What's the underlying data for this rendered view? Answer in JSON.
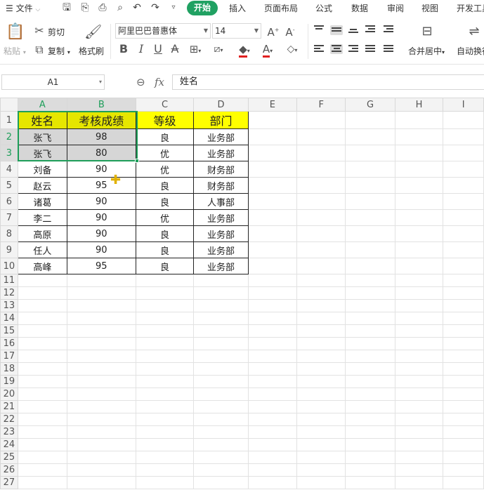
{
  "menu": {
    "file_label": "文件",
    "tabs": [
      "开始",
      "插入",
      "页面布局",
      "公式",
      "数据",
      "审阅",
      "视图",
      "开发工具"
    ]
  },
  "ribbon": {
    "paste": "粘贴",
    "cut": "剪切",
    "copy": "复制",
    "format_painter": "格式刷",
    "font_name": "阿里巴巴普惠体",
    "font_size": "14",
    "merge_center": "合并居中",
    "auto_wrap": "自动换行"
  },
  "formula_bar": {
    "cell_ref": "A1",
    "fx": "fx",
    "content": "姓名"
  },
  "sheet": {
    "columns": [
      "A",
      "B",
      "C",
      "D",
      "E",
      "F",
      "G",
      "H",
      "I"
    ],
    "headers": [
      "姓名",
      "考核成绩",
      "等级",
      "部门"
    ],
    "rows": [
      [
        "张飞",
        "98",
        "良",
        "业务部"
      ],
      [
        "张飞",
        "80",
        "优",
        "业务部"
      ],
      [
        "刘备",
        "90",
        "优",
        "财务部"
      ],
      [
        "赵云",
        "95",
        "良",
        "财务部"
      ],
      [
        "诸葛",
        "90",
        "良",
        "人事部"
      ],
      [
        "李二",
        "90",
        "优",
        "业务部"
      ],
      [
        "高原",
        "90",
        "良",
        "业务部"
      ],
      [
        "任人",
        "90",
        "良",
        "业务部"
      ],
      [
        "高峰",
        "95",
        "良",
        "业务部"
      ]
    ],
    "row_numbers": [
      "1",
      "2",
      "3",
      "4",
      "5",
      "6",
      "7",
      "8",
      "9",
      "10",
      "11",
      "12",
      "13",
      "14",
      "15",
      "16",
      "17",
      "18",
      "19",
      "20",
      "21",
      "22",
      "23",
      "24",
      "25",
      "26",
      "27"
    ]
  },
  "colors": {
    "accent": "#20a162",
    "selection": "#1e9e5a",
    "header_fill": "#ffff00"
  },
  "icons": [
    "menu-icon",
    "save-icon",
    "export-pdf-icon",
    "print-icon",
    "print-preview-icon",
    "undo-icon",
    "redo-icon",
    "more-icon",
    "cut-icon",
    "copy-icon",
    "format-painter-icon",
    "zoom-icon",
    "crosshair-cursor-icon"
  ]
}
